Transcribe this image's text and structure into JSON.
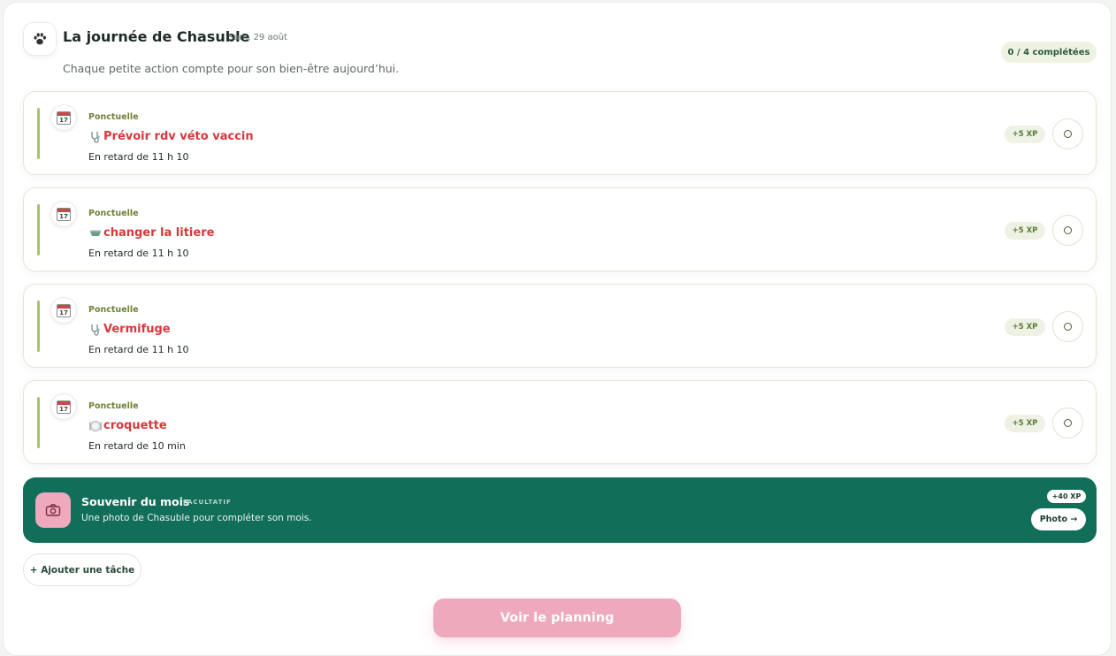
{
  "header": {
    "icon": "paw-icon",
    "title": "La journée de Chasuble",
    "date": "Sam. 29 août",
    "subtitle": "Chaque petite action compte pour son bien-être aujourd’hui.",
    "progress": "0 / 4 complétées"
  },
  "tasks": [
    {
      "kind": "Ponctuelle",
      "emoji": "stethoscope-icon",
      "name": "Prévoir rdv véto vaccin",
      "late": "En retard de 11 h 10",
      "xp": "+5 XP"
    },
    {
      "kind": "Ponctuelle",
      "emoji": "litter-icon",
      "name": "changer la litiere",
      "late": "En retard de 11 h 10",
      "xp": "+5 XP"
    },
    {
      "kind": "Ponctuelle",
      "emoji": "stethoscope-icon",
      "name": "Vermifuge",
      "late": "En retard de 11 h 10",
      "xp": "+5 XP"
    },
    {
      "kind": "Ponctuelle",
      "emoji": "plate-icon",
      "name": "croquette",
      "late": "En retard de 10 min",
      "xp": "+5 XP"
    }
  ],
  "calendar_day": "17",
  "souvenir": {
    "title": "Souvenir du mois",
    "tag": "FACULTATIF",
    "description": "Une photo de Chasuble pour compléter son mois.",
    "xp": "+40 XP",
    "button": "Photo →",
    "icon": "camera-icon"
  },
  "actions": {
    "add_task": "+ Ajouter une tâche",
    "planning": "Voir le planning"
  },
  "colors": {
    "accent_green": "#116e58",
    "late_red": "#d9373b",
    "pink": "#eea9bd",
    "bar_green": "#a7c46a"
  }
}
